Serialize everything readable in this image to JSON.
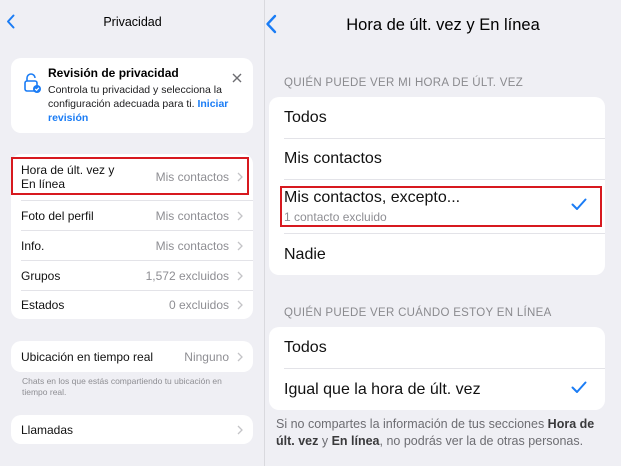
{
  "left": {
    "nav": {
      "title": "Privacidad"
    },
    "banner": {
      "title": "Revisión de privacidad",
      "text": "Controla tu privacidad y selecciona la configuración adecuada para ti.",
      "link": "Iniciar revisión"
    },
    "settings": [
      {
        "label": "Hora de últ. vez y En línea",
        "value": "Mis contactos"
      },
      {
        "label": "Foto del perfil",
        "value": "Mis contactos"
      },
      {
        "label": "Info.",
        "value": "Mis contactos"
      },
      {
        "label": "Grupos",
        "value": "1,572 excluidos"
      },
      {
        "label": "Estados",
        "value": "0 excluidos"
      }
    ],
    "live_location": {
      "label": "Ubicación en tiempo real",
      "value": "Ninguno",
      "note": "Chats en los que estás compartiendo tu ubicación en tiempo real."
    },
    "calls": {
      "label": "Llamadas"
    }
  },
  "right": {
    "nav": {
      "title": "Hora de últ. vez y En línea"
    },
    "last_seen": {
      "header": "QUIÉN PUEDE VER MI HORA DE ÚLT. VEZ",
      "options": [
        {
          "label": "Todos"
        },
        {
          "label": "Mis contactos"
        },
        {
          "label": "Mis contactos, excepto...",
          "sub": "1 contacto excluido",
          "selected": true
        },
        {
          "label": "Nadie"
        }
      ]
    },
    "online": {
      "header": "QUIÉN PUEDE VER CUÁNDO ESTOY EN LÍNEA",
      "options": [
        {
          "label": "Todos"
        },
        {
          "label": "Igual que la hora de últ. vez",
          "selected": true
        }
      ]
    },
    "footnote": {
      "part1": "Si no compartes la información de tus secciones ",
      "bold1": "Hora de últ. vez",
      "part2": " y ",
      "bold2": "En línea",
      "part3": ", no podrás ver la de otras personas."
    }
  },
  "colors": {
    "accent": "#1a7cf5",
    "highlight": "#d7191f",
    "background": "#efeff4"
  },
  "icons": {
    "back": "chevron-left-icon",
    "lock": "lock-check-icon",
    "close": "close-icon",
    "chevron": "chevron-right-icon",
    "check": "checkmark-icon"
  }
}
